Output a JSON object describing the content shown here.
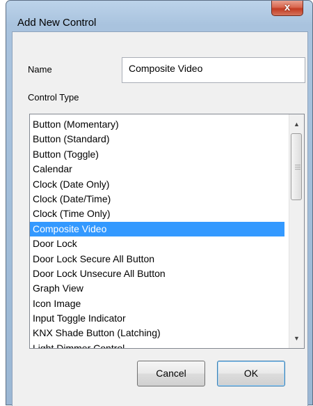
{
  "window": {
    "title": "Add New Control",
    "close_glyph": "x"
  },
  "form": {
    "name_label": "Name",
    "name_value": "Composite Video",
    "control_type_label": "Control Type"
  },
  "list": {
    "selected_index": 7,
    "items": [
      "Button (Momentary)",
      "Button (Standard)",
      "Button (Toggle)",
      "Calendar",
      "Clock (Date Only)",
      "Clock (Date/Time)",
      "Clock (Time Only)",
      "Composite Video",
      "Door Lock",
      "Door Lock Secure All Button",
      "Door Lock Unsecure All Button",
      "Graph View",
      "Icon Image",
      "Input Toggle Indicator",
      "KNX Shade Button (Latching)",
      "Light Dimmer Control"
    ]
  },
  "buttons": {
    "cancel_label": "Cancel",
    "ok_label": "OK"
  },
  "colors": {
    "selection": "#3399ff",
    "close_button": "#c23b22"
  },
  "icons": {
    "scroll_up": "up-arrow-icon",
    "scroll_down": "down-arrow-icon",
    "close": "close-icon"
  }
}
